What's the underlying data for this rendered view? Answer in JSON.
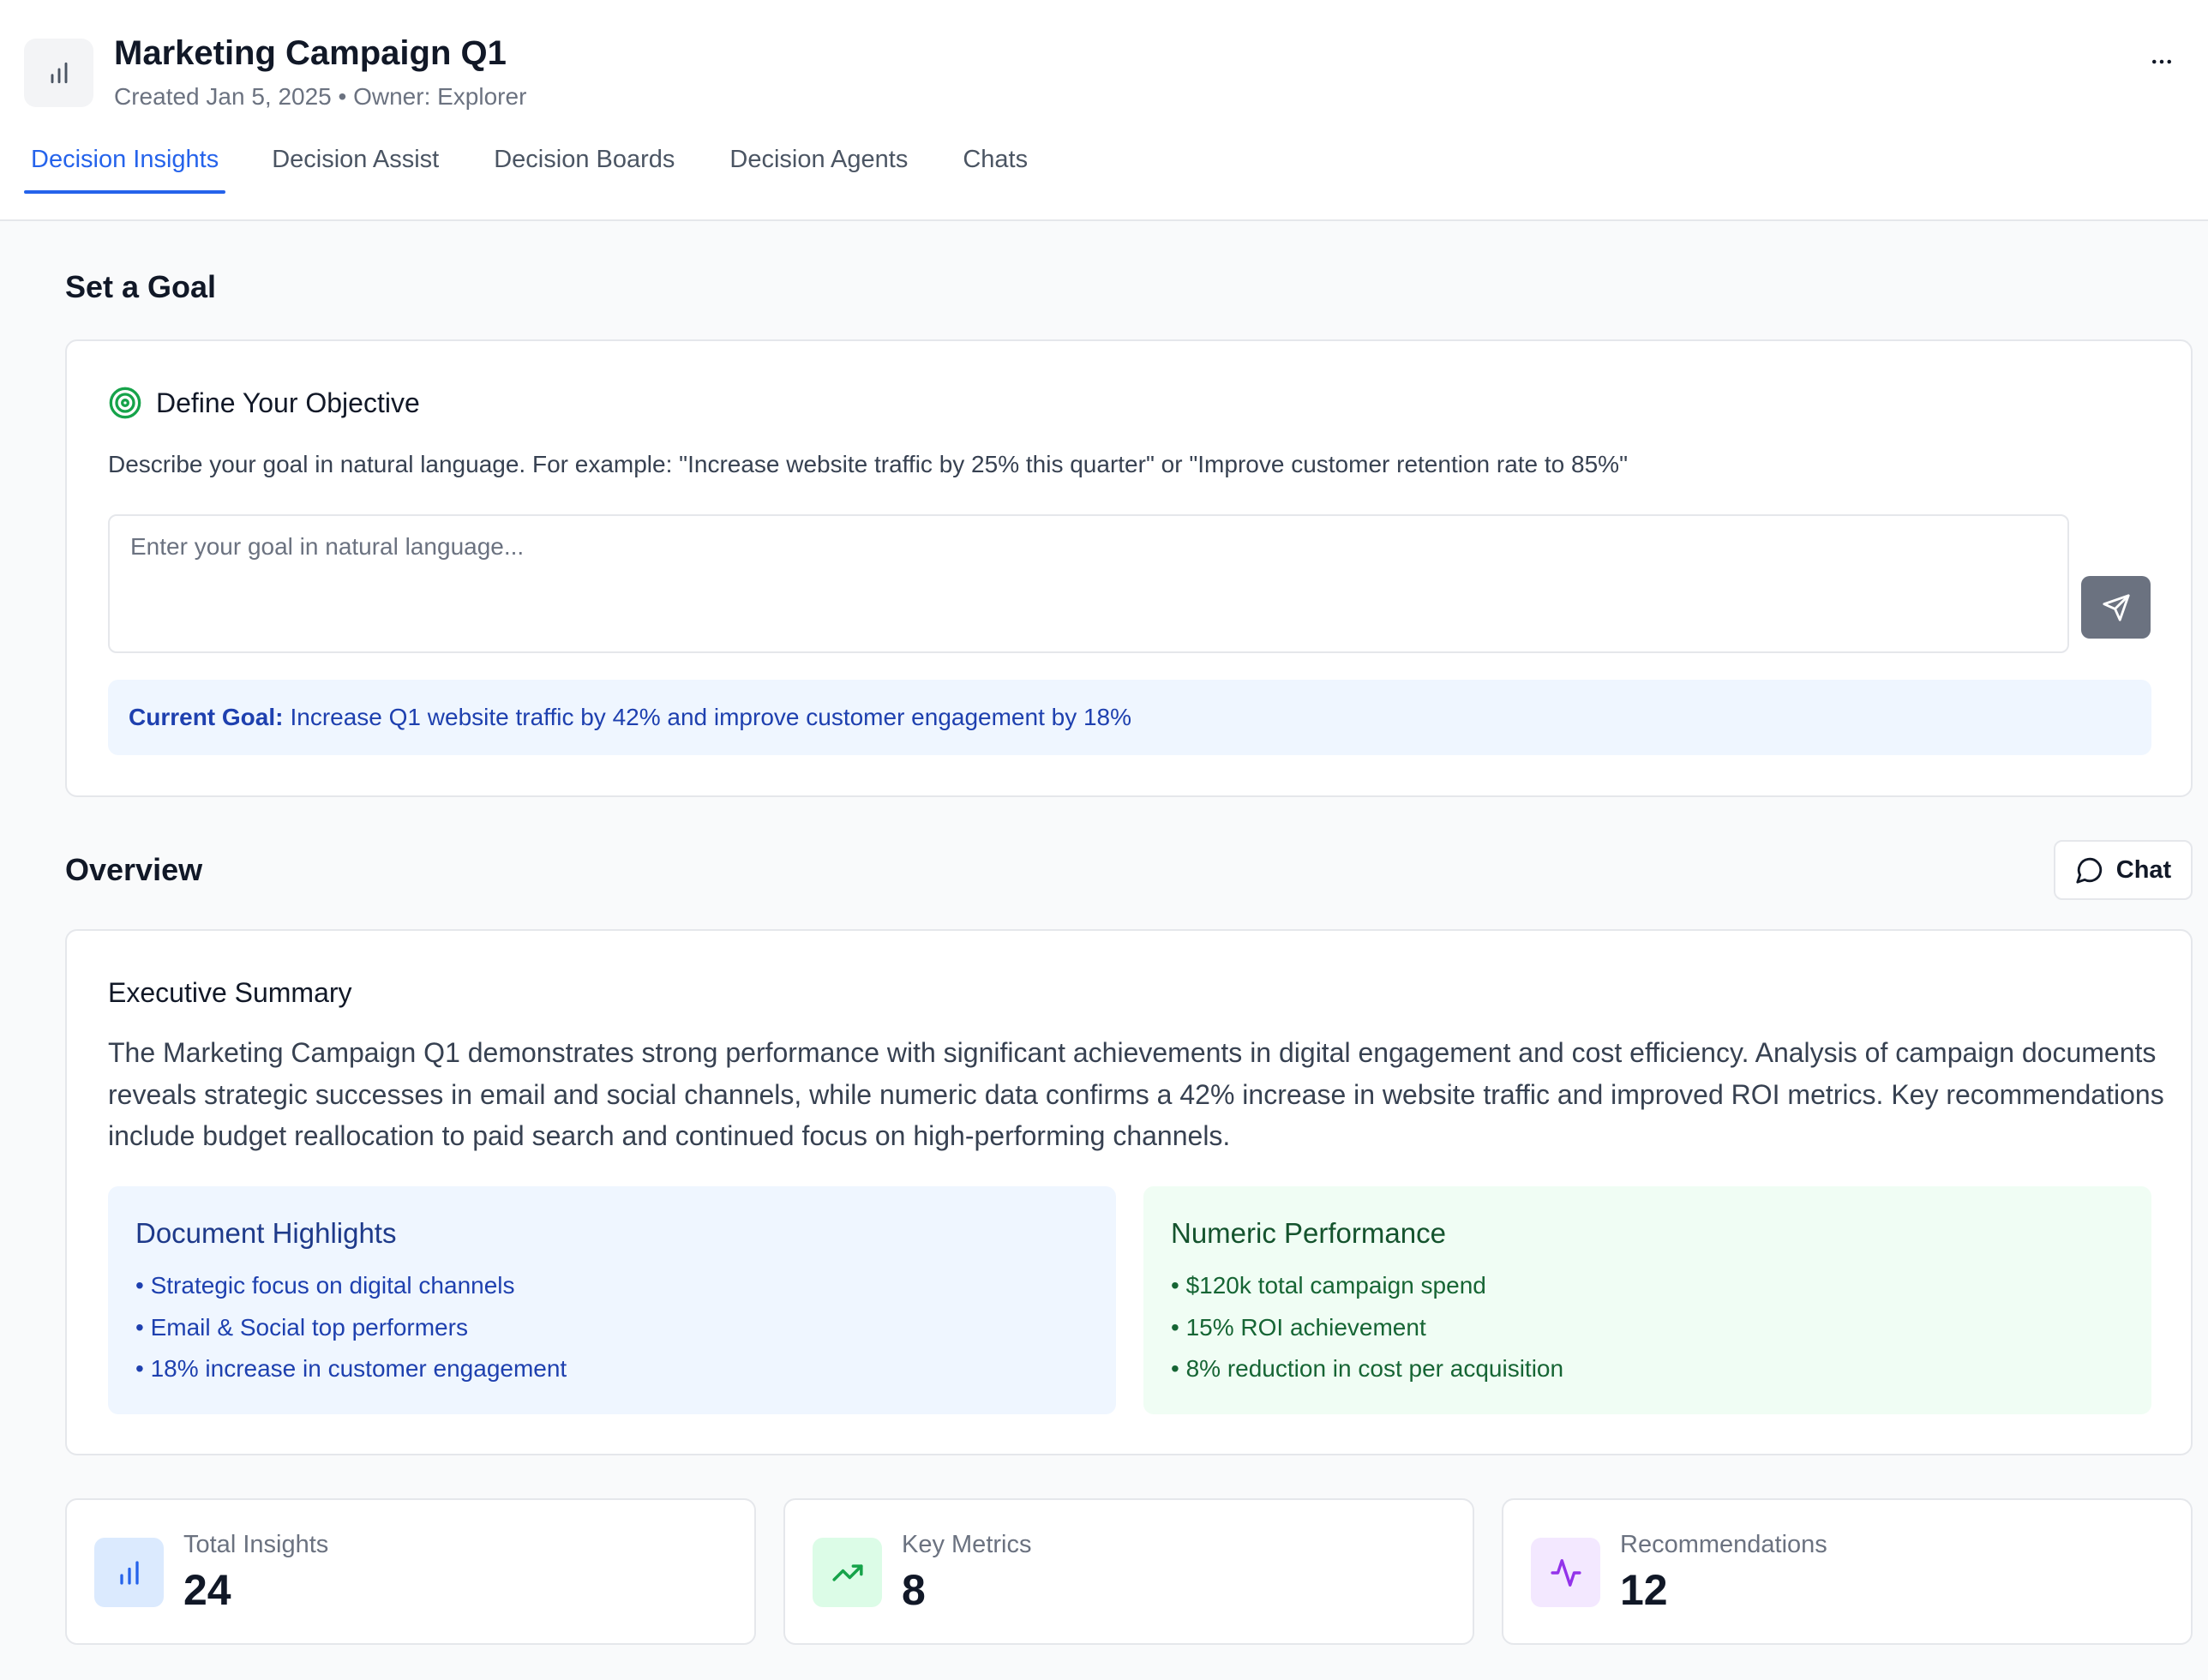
{
  "header": {
    "title": "Marketing Campaign Q1",
    "meta": "Created Jan 5, 2025 • Owner: Explorer",
    "icon": "bar-chart-icon",
    "more_icon": "more-horizontal-icon"
  },
  "tabs": [
    {
      "label": "Decision Insights",
      "active": true
    },
    {
      "label": "Decision Assist",
      "active": false
    },
    {
      "label": "Decision Boards",
      "active": false
    },
    {
      "label": "Decision Agents",
      "active": false
    },
    {
      "label": "Chats",
      "active": false
    }
  ],
  "goal_section": {
    "heading": "Set a Goal",
    "card_title": "Define Your Objective",
    "card_icon": "target-icon",
    "description": "Describe your goal in natural language. For example: \"Increase website traffic by 25% this quarter\" or \"Improve customer retention rate to 85%\"",
    "input": {
      "placeholder": "Enter your goal in natural language...",
      "value": ""
    },
    "send_icon": "send-icon",
    "current_goal_label": "Current Goal:",
    "current_goal_text": "Increase Q1 website traffic by 42% and improve customer engagement by 18%"
  },
  "overview": {
    "heading": "Overview",
    "chat_button": "Chat",
    "chat_icon": "message-circle-icon",
    "exec_title": "Executive Summary",
    "exec_text": "The Marketing Campaign Q1 demonstrates strong performance with significant achievements in digital engagement and cost efficiency. Analysis of campaign documents reveals strategic successes in email and social channels, while numeric data confirms a 42% increase in website traffic and improved ROI metrics. Key recommendations include budget reallocation to paid search and continued focus on high-performing channels.",
    "document_highlights": {
      "title": "Document Highlights",
      "items": [
        "Strategic focus on digital channels",
        "Email & Social top performers",
        "18% increase in customer engagement"
      ]
    },
    "numeric_performance": {
      "title": "Numeric Performance",
      "items": [
        "$120k total campaign spend",
        "15% ROI achievement",
        "8% reduction in cost per acquisition"
      ]
    }
  },
  "stats": [
    {
      "label": "Total Insights",
      "value": "24",
      "icon": "bar-chart-icon",
      "color": "#2563eb",
      "bg": "#dbeafe"
    },
    {
      "label": "Key Metrics",
      "value": "8",
      "icon": "trending-up-icon",
      "color": "#16a34a",
      "bg": "#dcfce7"
    },
    {
      "label": "Recommendations",
      "value": "12",
      "icon": "activity-icon",
      "color": "#9333ea",
      "bg": "#f3e8ff"
    }
  ],
  "colors": {
    "accent": "#2563eb",
    "page_bg": "#f9fafb",
    "goal_bg": "#eff6ff",
    "numeric_bg": "#f0fdf4"
  }
}
